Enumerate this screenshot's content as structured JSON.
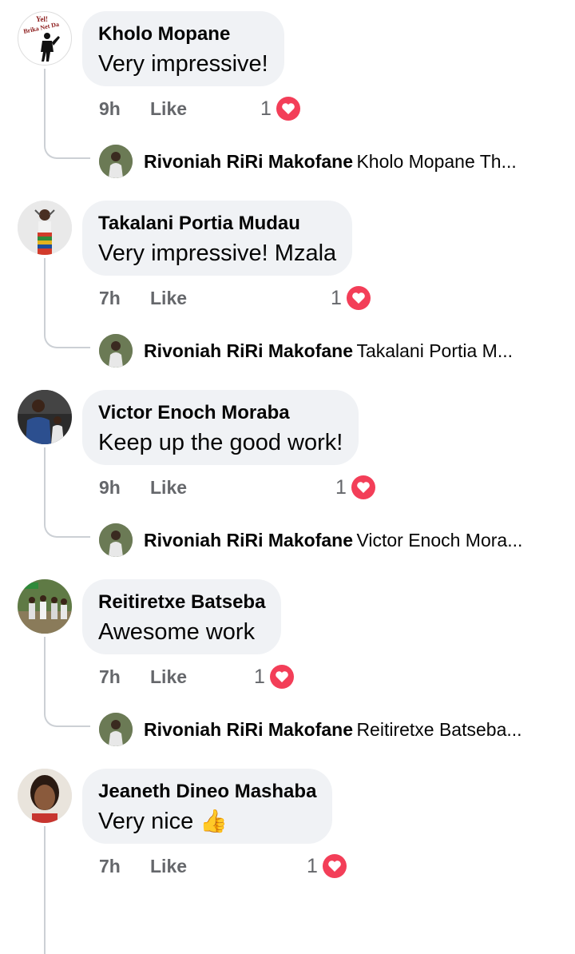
{
  "comments": [
    {
      "author": "Kholo Mopane",
      "text": "Very impressive!",
      "time": "9h",
      "like_label": "Like",
      "reaction_count": "1",
      "reply": {
        "author": "Rivoniah RiRi Makofane",
        "preview": "Kholo Mopane Th..."
      }
    },
    {
      "author": "Takalani Portia Mudau",
      "text": "Very impressive! Mzala",
      "time": "7h",
      "like_label": "Like",
      "reaction_count": "1",
      "reply": {
        "author": "Rivoniah RiRi Makofane",
        "preview": "Takalani Portia M..."
      }
    },
    {
      "author": "Victor Enoch Moraba",
      "text": "Keep up the good work!",
      "time": "9h",
      "like_label": "Like",
      "reaction_count": "1",
      "reply": {
        "author": "Rivoniah RiRi Makofane",
        "preview": "Victor Enoch Mora..."
      }
    },
    {
      "author": "Reitiretxe Batseba",
      "text": "Awesome work",
      "time": "7h",
      "like_label": "Like",
      "reaction_count": "1",
      "reply": {
        "author": "Rivoniah RiRi Makofane",
        "preview": "Reitiretxe Batseba..."
      }
    },
    {
      "author": "Jeaneth Dineo Mashaba",
      "text": "Very nice",
      "emoji": "👍",
      "time": "7h",
      "like_label": "Like",
      "reaction_count": "1"
    }
  ],
  "logo_text": {
    "line1": "Yel!",
    "line2": "Brika Net Da"
  },
  "icons": {
    "reaction": "heart-icon",
    "reaction_color": "#f33e58"
  }
}
